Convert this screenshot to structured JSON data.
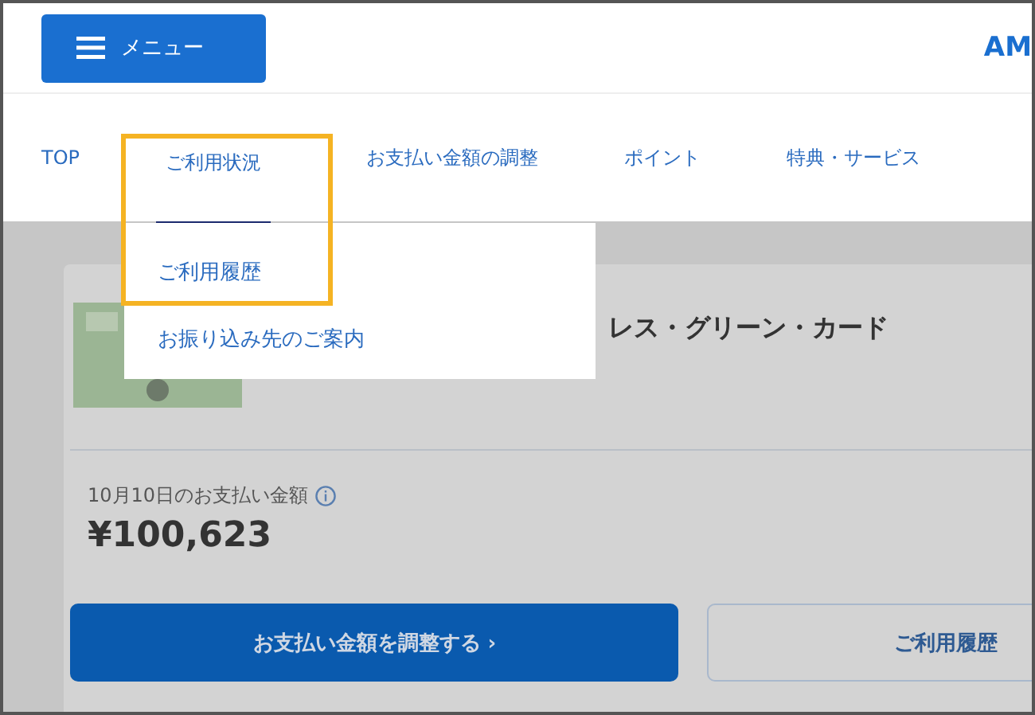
{
  "header": {
    "menu_button": "メニュー",
    "logo": "AM"
  },
  "nav": {
    "tabs": [
      {
        "label": "TOP",
        "selected": false
      },
      {
        "label": "ご利用状況",
        "selected": true
      },
      {
        "label": "お支払い金額の調整",
        "selected": false
      },
      {
        "label": "ポイント",
        "selected": false
      },
      {
        "label": "特典・サービス",
        "selected": false
      }
    ]
  },
  "dropdown": {
    "items": [
      {
        "label": "ご利用履歴"
      },
      {
        "label": "お振り込み先のご案内"
      }
    ]
  },
  "card": {
    "name": "レス・グリーン・カード",
    "payment_label": "10月10日のお支払い金額",
    "amount": "¥100,623",
    "buttons": [
      {
        "label": "お支払い金額を調整する ›",
        "kind": "primary"
      },
      {
        "label": "ご利用履歴",
        "kind": "secondary"
      }
    ]
  }
}
